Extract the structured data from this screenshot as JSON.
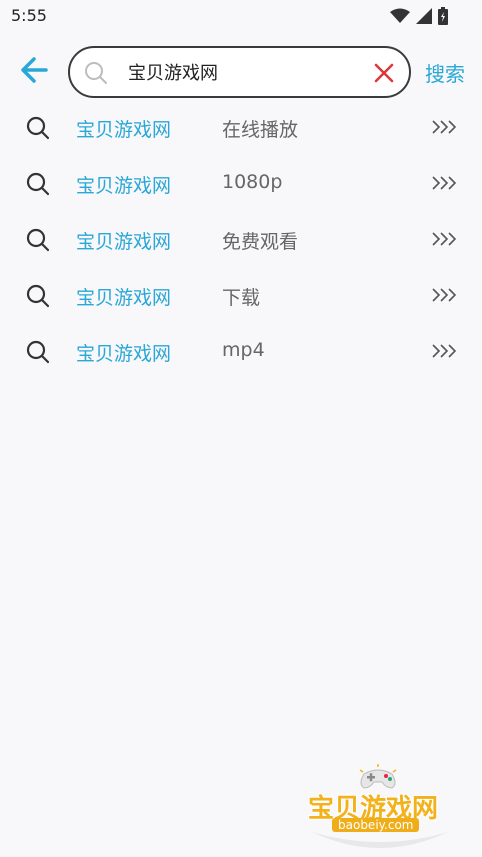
{
  "status_bar": {
    "time": "5:55",
    "icons": [
      "wifi-icon",
      "signal-icon",
      "battery-icon"
    ]
  },
  "header": {
    "back_icon": "arrow-left-icon",
    "search": {
      "value": "宝贝游戏网",
      "placeholder": "",
      "clear_icon": "close-icon"
    },
    "search_button": "搜索"
  },
  "suggestions": [
    {
      "keyword": "宝贝游戏网",
      "term": "在线播放"
    },
    {
      "keyword": "宝贝游戏网",
      "term": "1080p"
    },
    {
      "keyword": "宝贝游戏网",
      "term": "免费观看"
    },
    {
      "keyword": "宝贝游戏网",
      "term": "下载"
    },
    {
      "keyword": "宝贝游戏网",
      "term": "mp4"
    }
  ],
  "logo": {
    "title": "宝贝游戏网",
    "domain": "baobeiy.com"
  },
  "colors": {
    "accent": "#2aa7d6",
    "clear": "#d9373a",
    "logo": "#f3b21b"
  }
}
